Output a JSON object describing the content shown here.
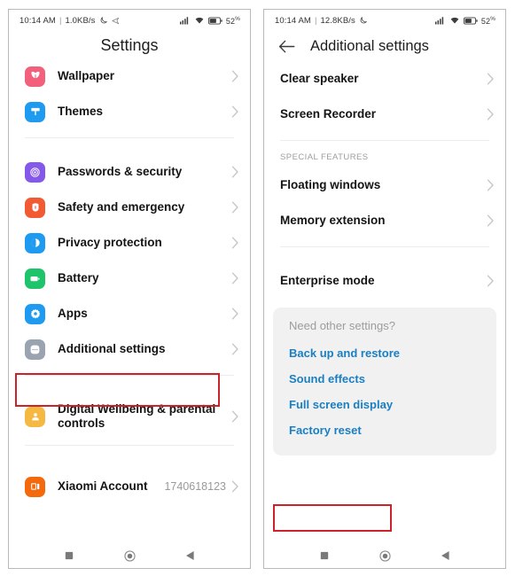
{
  "left_phone": {
    "status_bar": {
      "time": "10:14 AM",
      "separator": "|",
      "network_speed": "1.0KB/s",
      "icons": [
        "moon-icon",
        "share-icon"
      ],
      "signal_icon": "cellular-signal-icon",
      "wifi_icon": "wifi-icon",
      "battery_icon": "battery-icon",
      "battery_percent": "52",
      "battery_percent_symbol": "%"
    },
    "title": "Settings",
    "groups": [
      {
        "items": [
          {
            "label": "Wallpaper",
            "icon": "wallpaper-icon",
            "icon_color": "#f2607c",
            "chevron": true
          },
          {
            "label": "Themes",
            "icon": "themes-icon",
            "icon_color": "#1e9bf0",
            "chevron": true
          }
        ]
      },
      {
        "items": [
          {
            "label": "Passwords & security",
            "icon": "fingerprint-icon",
            "icon_color": "#8458e8",
            "chevron": true
          },
          {
            "label": "Safety and emergency",
            "icon": "safety-shield-icon",
            "icon_color": "#f15a33",
            "chevron": true
          },
          {
            "label": "Privacy protection",
            "icon": "privacy-icon",
            "icon_color": "#1e9bf0",
            "chevron": true
          },
          {
            "label": "Battery",
            "icon": "battery-settings-icon",
            "icon_color": "#1ec46b",
            "chevron": true
          },
          {
            "label": "Apps",
            "icon": "apps-gear-icon",
            "icon_color": "#1e9bf0",
            "chevron": true
          },
          {
            "label": "Additional settings",
            "icon": "additional-settings-icon",
            "icon_color": "#9aa4b0",
            "chevron": true,
            "highlighted": true
          }
        ]
      },
      {
        "items": [
          {
            "label": "Digital Wellbeing & parental controls",
            "icon": "digital-wellbeing-icon",
            "icon_color": "#f5b942",
            "chevron": true
          }
        ]
      },
      {
        "items": [
          {
            "label": "Xiaomi Account",
            "icon": "xiaomi-icon",
            "icon_color": "#f4690c",
            "value": "1740618123",
            "chevron": true
          }
        ]
      }
    ],
    "nav_bar": {
      "recents": "recents-square-icon",
      "home": "home-circle-icon",
      "back": "back-triangle-icon"
    }
  },
  "right_phone": {
    "status_bar": {
      "time": "10:14 AM",
      "separator": "|",
      "network_speed": "12.8KB/s",
      "icons": [
        "moon-icon"
      ],
      "signal_icon": "cellular-signal-icon",
      "wifi_icon": "wifi-icon",
      "battery_icon": "battery-icon",
      "battery_percent": "52",
      "battery_percent_symbol": "%"
    },
    "back_icon": "back-arrow-icon",
    "title": "Additional settings",
    "items_top": [
      {
        "label": "Clear speaker",
        "chevron": true
      },
      {
        "label": "Screen Recorder",
        "chevron": true
      }
    ],
    "section_label": "SPECIAL FEATURES",
    "items_special": [
      {
        "label": "Floating windows",
        "chevron": true
      },
      {
        "label": "Memory extension",
        "chevron": true
      }
    ],
    "items_enterprise": [
      {
        "label": "Enterprise mode",
        "chevron": true
      }
    ],
    "card": {
      "title": "Need other settings?",
      "links": [
        {
          "label": "Back up and restore",
          "highlighted": false
        },
        {
          "label": "Sound effects",
          "highlighted": false
        },
        {
          "label": "Full screen display",
          "highlighted": false
        },
        {
          "label": "Factory reset",
          "highlighted": true
        }
      ],
      "background_color": "#f1f1f1",
      "link_color": "#1a7fc1"
    },
    "nav_bar": {
      "recents": "recents-square-icon",
      "home": "home-circle-icon",
      "back": "back-triangle-icon"
    }
  },
  "annotations": {
    "highlight_color": "#cc2229",
    "boxes": [
      {
        "target": "Additional settings",
        "phone": "left"
      },
      {
        "target": "Factory reset",
        "phone": "right"
      }
    ]
  }
}
